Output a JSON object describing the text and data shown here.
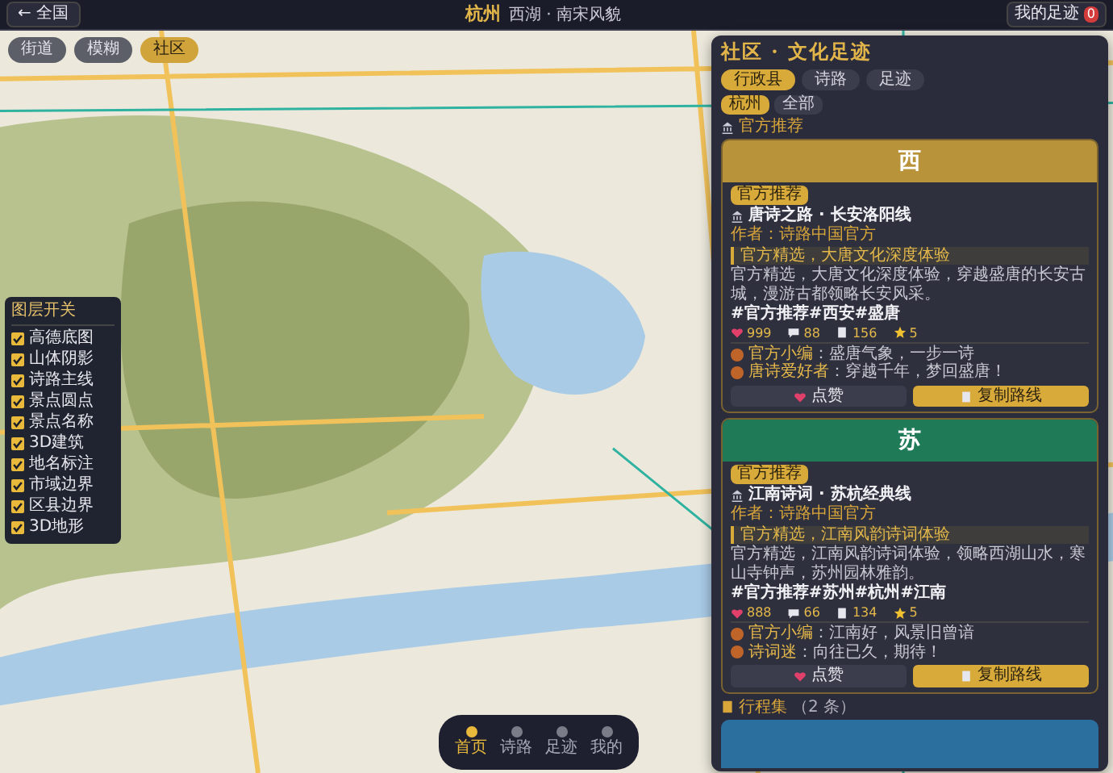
{
  "header": {
    "back_button": "← 全国",
    "city": "杭州",
    "subtitle": "西湖 · 南宋风貌",
    "footprint_button": "我的足迹",
    "footprint_count": "0"
  },
  "view_pills": [
    {
      "label": "街道",
      "selected": false
    },
    {
      "label": "模糊",
      "selected": false
    },
    {
      "label": "社区",
      "selected": true
    }
  ],
  "layers": {
    "title": "图层开关",
    "items": [
      {
        "label": "高德底图",
        "checked": true
      },
      {
        "label": "山体阴影",
        "checked": true
      },
      {
        "label": "诗路主线",
        "checked": true
      },
      {
        "label": "景点圆点",
        "checked": true
      },
      {
        "label": "景点名称",
        "checked": true
      },
      {
        "label": "3D建筑",
        "checked": true
      },
      {
        "label": "地名标注",
        "checked": true
      },
      {
        "label": "市域边界",
        "checked": true
      },
      {
        "label": "区县边界",
        "checked": true
      },
      {
        "label": "3D地形",
        "checked": true
      }
    ]
  },
  "panel": {
    "title": "社区 · 文化足迹",
    "tabs": [
      {
        "label": "行政县",
        "selected": true
      },
      {
        "label": "诗路",
        "selected": false
      },
      {
        "label": "足迹",
        "selected": false
      }
    ],
    "chips": [
      {
        "label": "杭州",
        "selected": true
      },
      {
        "label": "全部",
        "selected": false
      }
    ],
    "section": "官方推荐",
    "cards": [
      {
        "glyph": "西",
        "color": "#b8933a",
        "badge": "官方推荐",
        "title": "唐诗之路 · 长安洛阳线",
        "author": "作者：诗路中国官方",
        "quote": "官方精选，大唐文化深度体验",
        "description": "官方精选，大唐文化深度体验，穿越盛唐的长安古城，漫游古都领略长安风采。",
        "tags": "#官方推荐#西安#盛唐",
        "stats": [
          {
            "kind": "likes",
            "value": "999"
          },
          {
            "kind": "comments",
            "value": "88"
          },
          {
            "kind": "notes",
            "value": "156"
          },
          {
            "kind": "stars",
            "value": "5"
          }
        ],
        "comments": [
          {
            "user": "官方小编",
            "text": "：盛唐气象，一步一诗"
          },
          {
            "user": "唐诗爱好者",
            "text": "：穿越千年，梦回盛唐！"
          }
        ],
        "like_button": "点赞",
        "copy_button": "复制路线"
      },
      {
        "glyph": "苏",
        "color": "#1f7a58",
        "badge": "官方推荐",
        "title": "江南诗词 · 苏杭经典线",
        "author": "作者：诗路中国官方",
        "quote": "官方精选，江南风韵诗词体验",
        "description": "官方精选，江南风韵诗词体验，领略西湖山水，寒山寺钟声，苏州园林雅韵。",
        "tags": "#官方推荐#苏州#杭州#江南",
        "stats": [
          {
            "kind": "likes",
            "value": "888"
          },
          {
            "kind": "comments",
            "value": "66"
          },
          {
            "kind": "notes",
            "value": "134"
          },
          {
            "kind": "stars",
            "value": "5"
          }
        ],
        "comments": [
          {
            "user": "官方小编",
            "text": "：江南好，风景旧曾谙"
          },
          {
            "user": "诗词迷",
            "text": "：向往已久，期待！"
          }
        ],
        "like_button": "点赞",
        "copy_button": "复制路线"
      }
    ],
    "collection": {
      "title": "行程集",
      "count": "（2 条）",
      "color": "#2a6f9e"
    }
  },
  "dock": [
    {
      "label": "首页",
      "selected": true
    },
    {
      "label": "诗路",
      "selected": false
    },
    {
      "label": "足迹",
      "selected": false
    },
    {
      "label": "我的",
      "selected": false
    }
  ]
}
